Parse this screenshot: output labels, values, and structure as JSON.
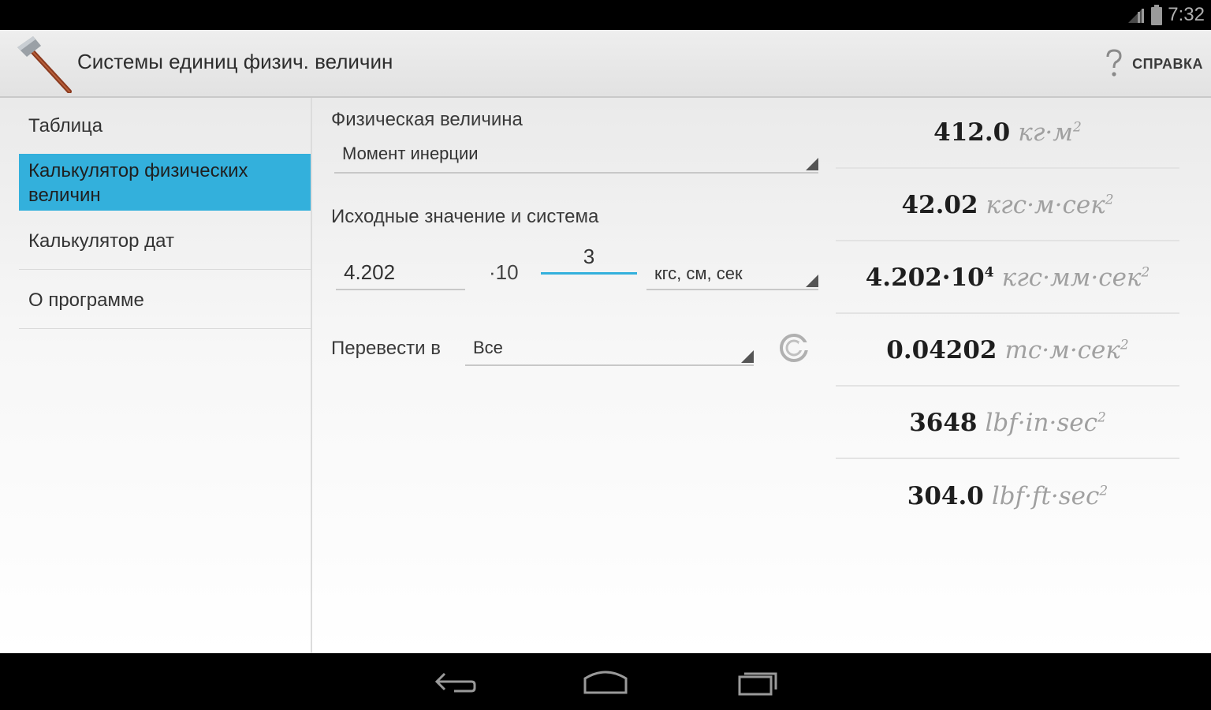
{
  "status_bar": {
    "time": "7:32",
    "icons": [
      "signal-icon",
      "battery-icon"
    ]
  },
  "action_bar": {
    "title": "Системы единиц физич. величин",
    "app_icon": "hammer-icon",
    "help_icon": "help-icon",
    "help_label": "СПРАВКА"
  },
  "sidebar": {
    "selected_index": 1,
    "items": [
      {
        "label": "Таблица"
      },
      {
        "label": "Калькулятор физических величин"
      },
      {
        "label": "Калькулятор дат"
      },
      {
        "label": "О программе"
      }
    ]
  },
  "form": {
    "quantity_label": "Физическая величина",
    "quantity_value": "Момент инерции",
    "source_label": "Исходные значение и система",
    "mantissa": "4.202",
    "times_ten": "·10",
    "exponent": "3",
    "unit_system": "кгс, см, сек",
    "convert_label": "Перевести в",
    "convert_value": "Все",
    "convert_icon": "refresh-icon"
  },
  "results": [
    {
      "value": "412.0",
      "unit": "кг·м",
      "power": "2"
    },
    {
      "value": "42.02",
      "unit": "кгс·м·сек",
      "power": "2"
    },
    {
      "value": "4.202·10",
      "value_power": "4",
      "unit": "кгс·мм·сек",
      "power": "2"
    },
    {
      "value": "0.04202",
      "unit": "тс·м·сек",
      "power": "2"
    },
    {
      "value": "3648",
      "unit": "lbf·in·sec",
      "power": "2"
    },
    {
      "value": "304.0",
      "unit": "lbf·ft·sec",
      "power": "2"
    }
  ],
  "nav_bar": {
    "back_icon": "back-icon",
    "home_icon": "home-icon",
    "recents_icon": "recents-icon"
  },
  "colors": {
    "accent": "#33b0dc",
    "action_bar": "#e8e8e8",
    "background": "#f5f5f5"
  }
}
